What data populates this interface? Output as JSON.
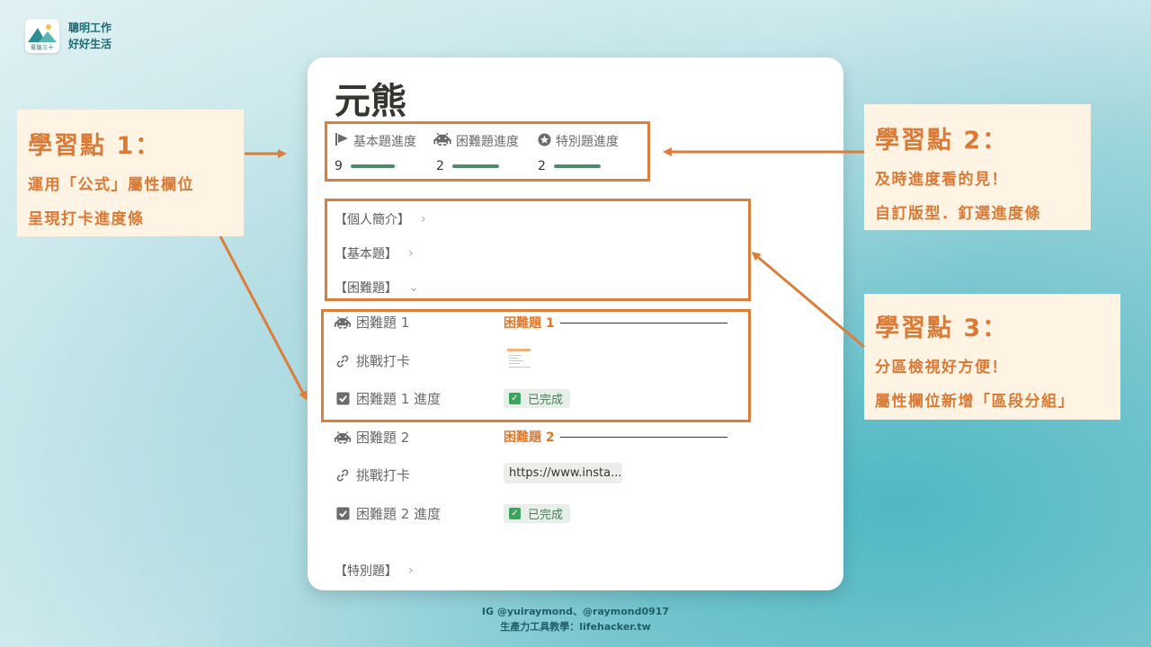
{
  "brand": {
    "logo_sub": "電腦三十",
    "line1": "聰明工作",
    "line2": "好好生活",
    "logo_icon": "mountain-icon"
  },
  "page": {
    "title": "元熊",
    "progress": [
      {
        "icon": "flag-icon",
        "label": "基本題進度",
        "value": "9",
        "fill": 0.95
      },
      {
        "icon": "space-invader-icon",
        "label": "困難題進度",
        "value": "2",
        "fill": 1.0
      },
      {
        "icon": "star-circle-icon",
        "label": "特別題進度",
        "value": "2",
        "fill": 1.0
      }
    ],
    "toggles": {
      "intro": "【個人簡介】",
      "basic": "【基本題】",
      "hard": "【困難題】",
      "special": "【特別題】"
    },
    "hard1": {
      "name": "困難題 1",
      "heading": "困難題 1",
      "challenge_label": "挑戰打卡",
      "progress_label": "困難題 1 進度",
      "status": "已完成"
    },
    "hard2": {
      "name": "困難題 2",
      "heading": "困難題 2",
      "challenge_label": "挑戰打卡",
      "url": "https://www.insta...",
      "progress_label": "困難題 2 進度",
      "status": "已完成"
    }
  },
  "callouts": {
    "p1": {
      "title": "學習點 1：",
      "line1": "運用「公式」屬性欄位",
      "line2": "呈現打卡進度條"
    },
    "p2": {
      "title": "學習點 2：",
      "line1": "及時進度看的見！",
      "line2": "自訂版型．釘選進度條"
    },
    "p3": {
      "title": "學習點 3：",
      "line1": "分區檢視好方便！",
      "line2": "屬性欄位新增「區段分組」"
    }
  },
  "footer": {
    "line1": "IG @yuiraymond、@raymond0917",
    "line2": "生產力工具教學：lifehacker.tw"
  },
  "colors": {
    "accent": "#dc7d3a",
    "callout_bg": "#fff3e3",
    "bar_fill": "#4f8a6d",
    "status_bg": "#e6f0e8"
  }
}
